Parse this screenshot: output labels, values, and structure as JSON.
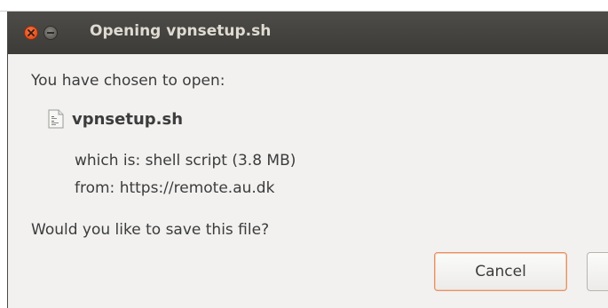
{
  "dialog": {
    "title": "Opening vpnsetup.sh",
    "prompt": "You have chosen to open:",
    "file": {
      "icon": "shell-script-file-icon",
      "name": "vpnsetup.sh",
      "type_line": "which is:  shell script (3.8 MB)",
      "from_line": "from:  https://remote.au.dk"
    },
    "question": "Would you like to save this file?",
    "buttons": {
      "cancel_label": "Cancel"
    }
  },
  "colors": {
    "titlebar": "#3c3b37",
    "title_text": "#dfdbd2",
    "close_button": "#e0501f",
    "dialog_bg": "#f2f1f0",
    "focus_border": "#e2936a"
  }
}
